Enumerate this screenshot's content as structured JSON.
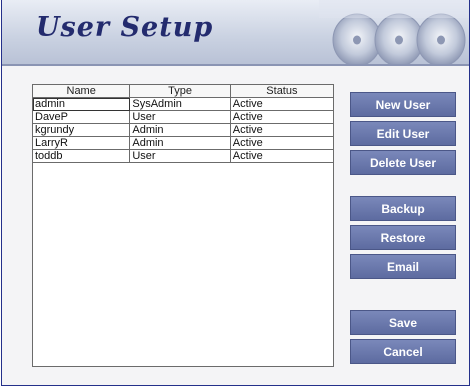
{
  "title": "User Setup",
  "table": {
    "columns": [
      "Name",
      "Type",
      "Status"
    ],
    "rows": [
      [
        "admin",
        "SysAdmin",
        "Active"
      ],
      [
        "DaveP",
        "User",
        "Active"
      ],
      [
        "kgrundy",
        "Admin",
        "Active"
      ],
      [
        "LarryR",
        "Admin",
        "Active"
      ],
      [
        "toddb",
        "User",
        "Active"
      ]
    ],
    "selected_row": 0
  },
  "buttons": {
    "new_user": "New User",
    "edit_user": "Edit User",
    "delete_user": "Delete User",
    "backup": "Backup",
    "restore": "Restore",
    "email": "Email",
    "save": "Save",
    "cancel": "Cancel"
  },
  "colors": {
    "button_bg": "#6b79ad",
    "title_text": "#232b6e",
    "header_bg": "#c9d1e1",
    "window_border": "#24308a"
  }
}
